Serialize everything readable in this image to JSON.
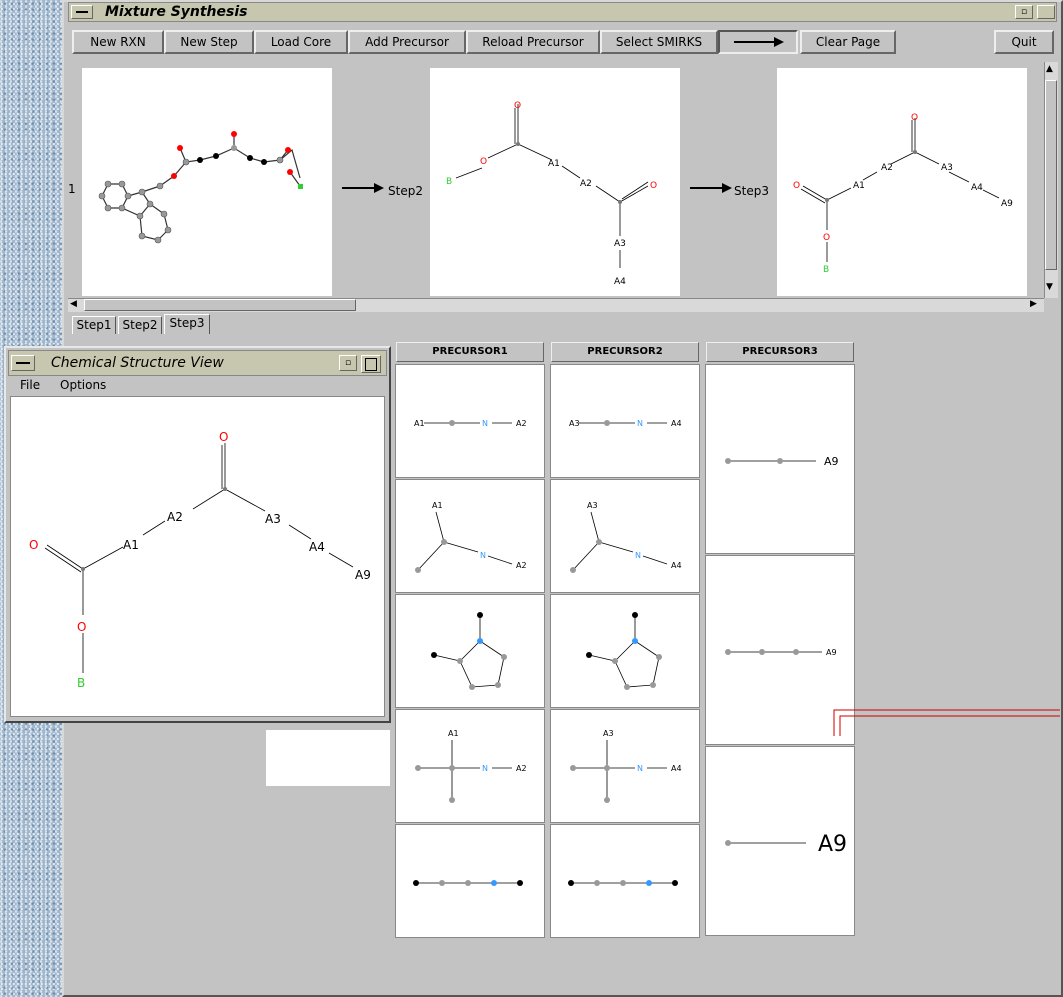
{
  "window": {
    "title": "Mixture Synthesis"
  },
  "toolbar": {
    "new_rxn": "New RXN",
    "new_step": "New Step",
    "load_core": "Load Core",
    "add_precursor": "Add Precursor",
    "reload_precursor": "Reload Precursor",
    "select_smirks": "Select SMIRKS",
    "clear_page": "Clear Page",
    "quit": "Quit"
  },
  "reaction": {
    "partial_label": "1",
    "arrow1_label": "Step2",
    "arrow2_label": "Step3"
  },
  "tabs": [
    "Step1",
    "Step2",
    "Step3"
  ],
  "columns": [
    "PRECURSOR1",
    "PRECURSOR2",
    "PRECURSOR3"
  ],
  "structure_labels": {
    "A1": "A1",
    "A2": "A2",
    "A3": "A3",
    "A4": "A4",
    "A9": "A9",
    "B": "B",
    "O": "O",
    "N": "N"
  },
  "chem_view": {
    "title": "Chemical Structure View",
    "menu_file": "File",
    "menu_options": "Options"
  },
  "colors": {
    "oxygen": "#ff0000",
    "boron": "#33cc33",
    "nitrogen": "#3399ff",
    "window_bg": "#c3c3c3",
    "titlebar": "#c7c7b0"
  }
}
